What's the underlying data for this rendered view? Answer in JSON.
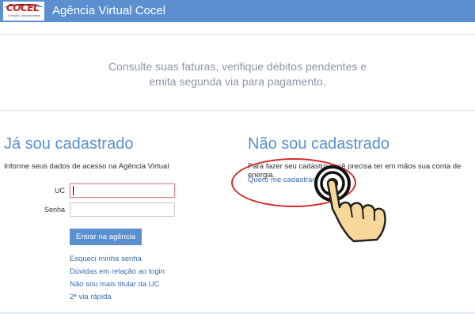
{
  "header": {
    "logo_text": "COCEL",
    "logo_subtext": "Energia Comprometida",
    "title": "Agência Virtual Cocel"
  },
  "hero": {
    "line1": "Consulte suas faturas, verifique débitos pendentes e",
    "line2": "emita segunda via para pagamento."
  },
  "left": {
    "title": "Já sou cadastrado",
    "info": "Informe seus dados de acesso na Agência Virtual",
    "uc_label": "UC",
    "senha_label": "Senha",
    "uc_value": "",
    "senha_value": "",
    "button_label": "Entrar na agência",
    "links": [
      "Esqueci minha senha",
      "Dúvidas em relação ao login",
      "Não sou mais titular da UC",
      "2ª via rápida"
    ]
  },
  "right": {
    "title": "Não sou cadastrado",
    "info": "Para fazer seu cadastro você precisa ter em mãos sua conta de energia.",
    "link": "Quero me cadastrar"
  },
  "colors": {
    "brand_blue": "#5b8fd0",
    "link_blue": "#3a6cb0",
    "highlight_red": "#d42a2a"
  },
  "annotations": {
    "pointer_icon": "hand-pointer-icon",
    "click_ripple_icon": "click-ripple-icon"
  }
}
